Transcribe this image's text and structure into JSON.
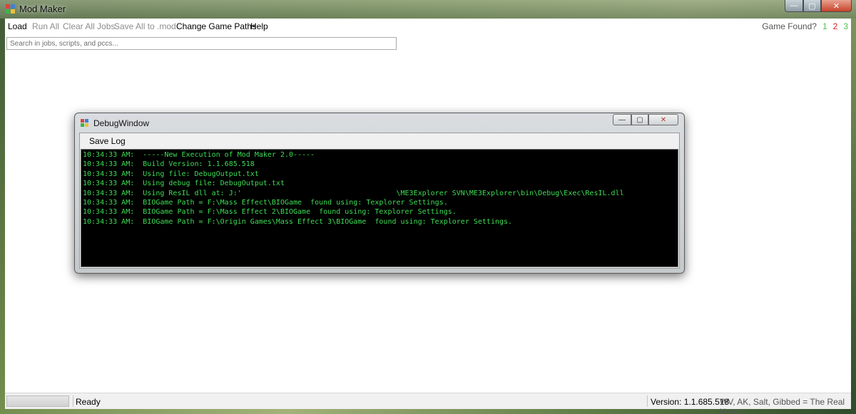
{
  "window": {
    "title": "Mod Maker",
    "controls": {
      "minimize": "—",
      "maximize": "▢",
      "close": "✕"
    },
    "icon_colors": [
      "#e04040",
      "#3f7fd6",
      "#3fb24a",
      "#e9c23b"
    ]
  },
  "menu": {
    "items": [
      {
        "label": "Load",
        "enabled": true
      },
      {
        "label": "Run All",
        "enabled": false
      },
      {
        "label": "Clear All Jobs",
        "enabled": false
      },
      {
        "label": "Save All to .mod",
        "enabled": false
      },
      {
        "label": "Change Game Paths",
        "enabled": true
      },
      {
        "label": "Help",
        "enabled": true
      }
    ],
    "game_found": {
      "label": "Game Found?",
      "games": [
        {
          "num": "1",
          "color": "#4fc44f"
        },
        {
          "num": "2",
          "color": "#d61f1f"
        },
        {
          "num": "3",
          "color": "#4fc44f"
        }
      ]
    }
  },
  "search": {
    "placeholder": "Search in jobs, scripts, and pccs..."
  },
  "status": {
    "progress_percent": 0,
    "text": "Ready",
    "version": "Version: 1.1.685.518",
    "credits": "WV, AK, Salt, Gibbed = The Real Heros"
  },
  "debug_window": {
    "title": "DebugWindow",
    "controls": {
      "minimize": "—",
      "maximize": "▢",
      "close": "✕"
    },
    "menu_item": "Save Log",
    "log_lines": [
      "10:34:33 AM:  -----New Execution of Mod Maker 2.0-----",
      "10:34:33 AM:  Build Version: 1.1.685.518",
      "10:34:33 AM:  Using file: DebugOutput.txt",
      "10:34:33 AM:  Using debug file: DebugOutput.txt",
      "10:34:33 AM:  Using ResIL dll at: J:'                                    \\ME3Explorer SVN\\ME3Explorer\\bin\\Debug\\Exec\\ResIL.dll",
      "10:34:33 AM:  BIOGame Path = F:\\Mass Effect\\BIOGame  found using: Texplorer Settings.",
      "10:34:33 AM:  BIOGame Path = F:\\Mass Effect 2\\BIOGame  found using: Texplorer Settings.",
      "10:34:33 AM:  BIOGame Path = F:\\Origin Games\\Mass Effect 3\\BIOGame  found using: Texplorer Settings."
    ]
  }
}
